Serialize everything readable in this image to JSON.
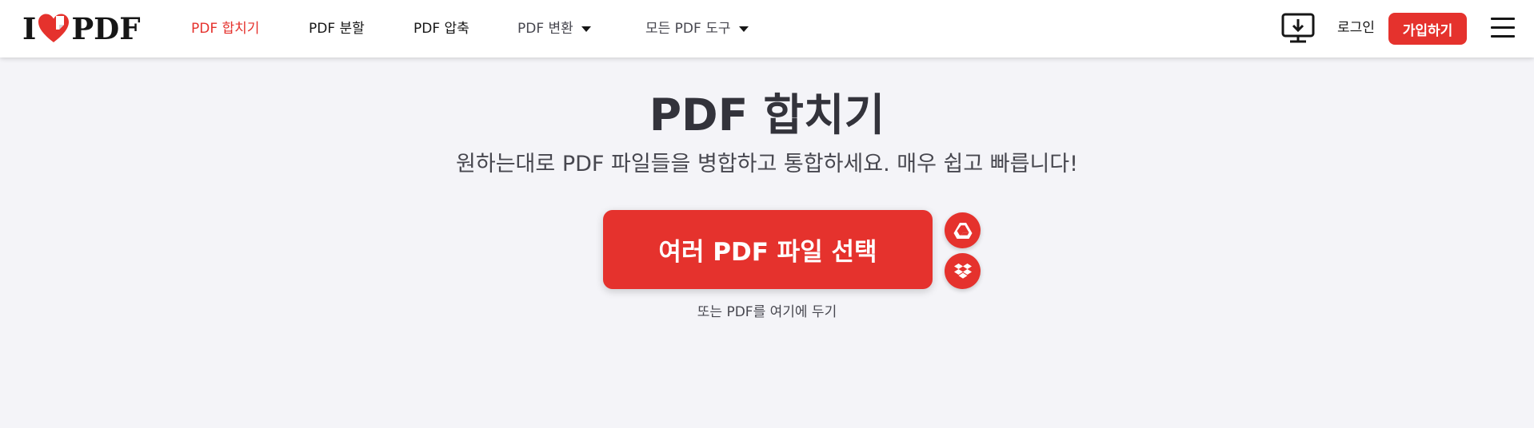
{
  "header": {
    "logo_text_left": "I",
    "logo_text_right": "PDF",
    "nav": [
      {
        "label": "PDF 합치기",
        "active": true,
        "dropdown": false
      },
      {
        "label": "PDF 분할",
        "active": false,
        "dropdown": false
      },
      {
        "label": "PDF 압축",
        "active": false,
        "dropdown": false
      },
      {
        "label": "PDF 변환",
        "active": false,
        "dropdown": true
      },
      {
        "label": "모든 PDF 도구",
        "active": false,
        "dropdown": true
      }
    ],
    "desktop_icon": "desktop-download-icon",
    "login_label": "로그인",
    "signup_label": "가입하기",
    "menu_icon": "hamburger-menu-icon"
  },
  "main": {
    "title": "PDF 합치기",
    "subtitle": "원하는대로 PDF 파일들을 병합하고 통합하세요. 매우 쉽고 빠릅니다!",
    "select_button_label": "여러 PDF 파일 선택",
    "cloud_icons": [
      "google-drive-icon",
      "dropbox-icon"
    ],
    "drop_hint": "또는 PDF를 여기에 두기"
  },
  "colors": {
    "accent": "#e5322d",
    "background": "#f4f4f8",
    "header_bg": "#ffffff",
    "text_dark": "#33333b"
  }
}
